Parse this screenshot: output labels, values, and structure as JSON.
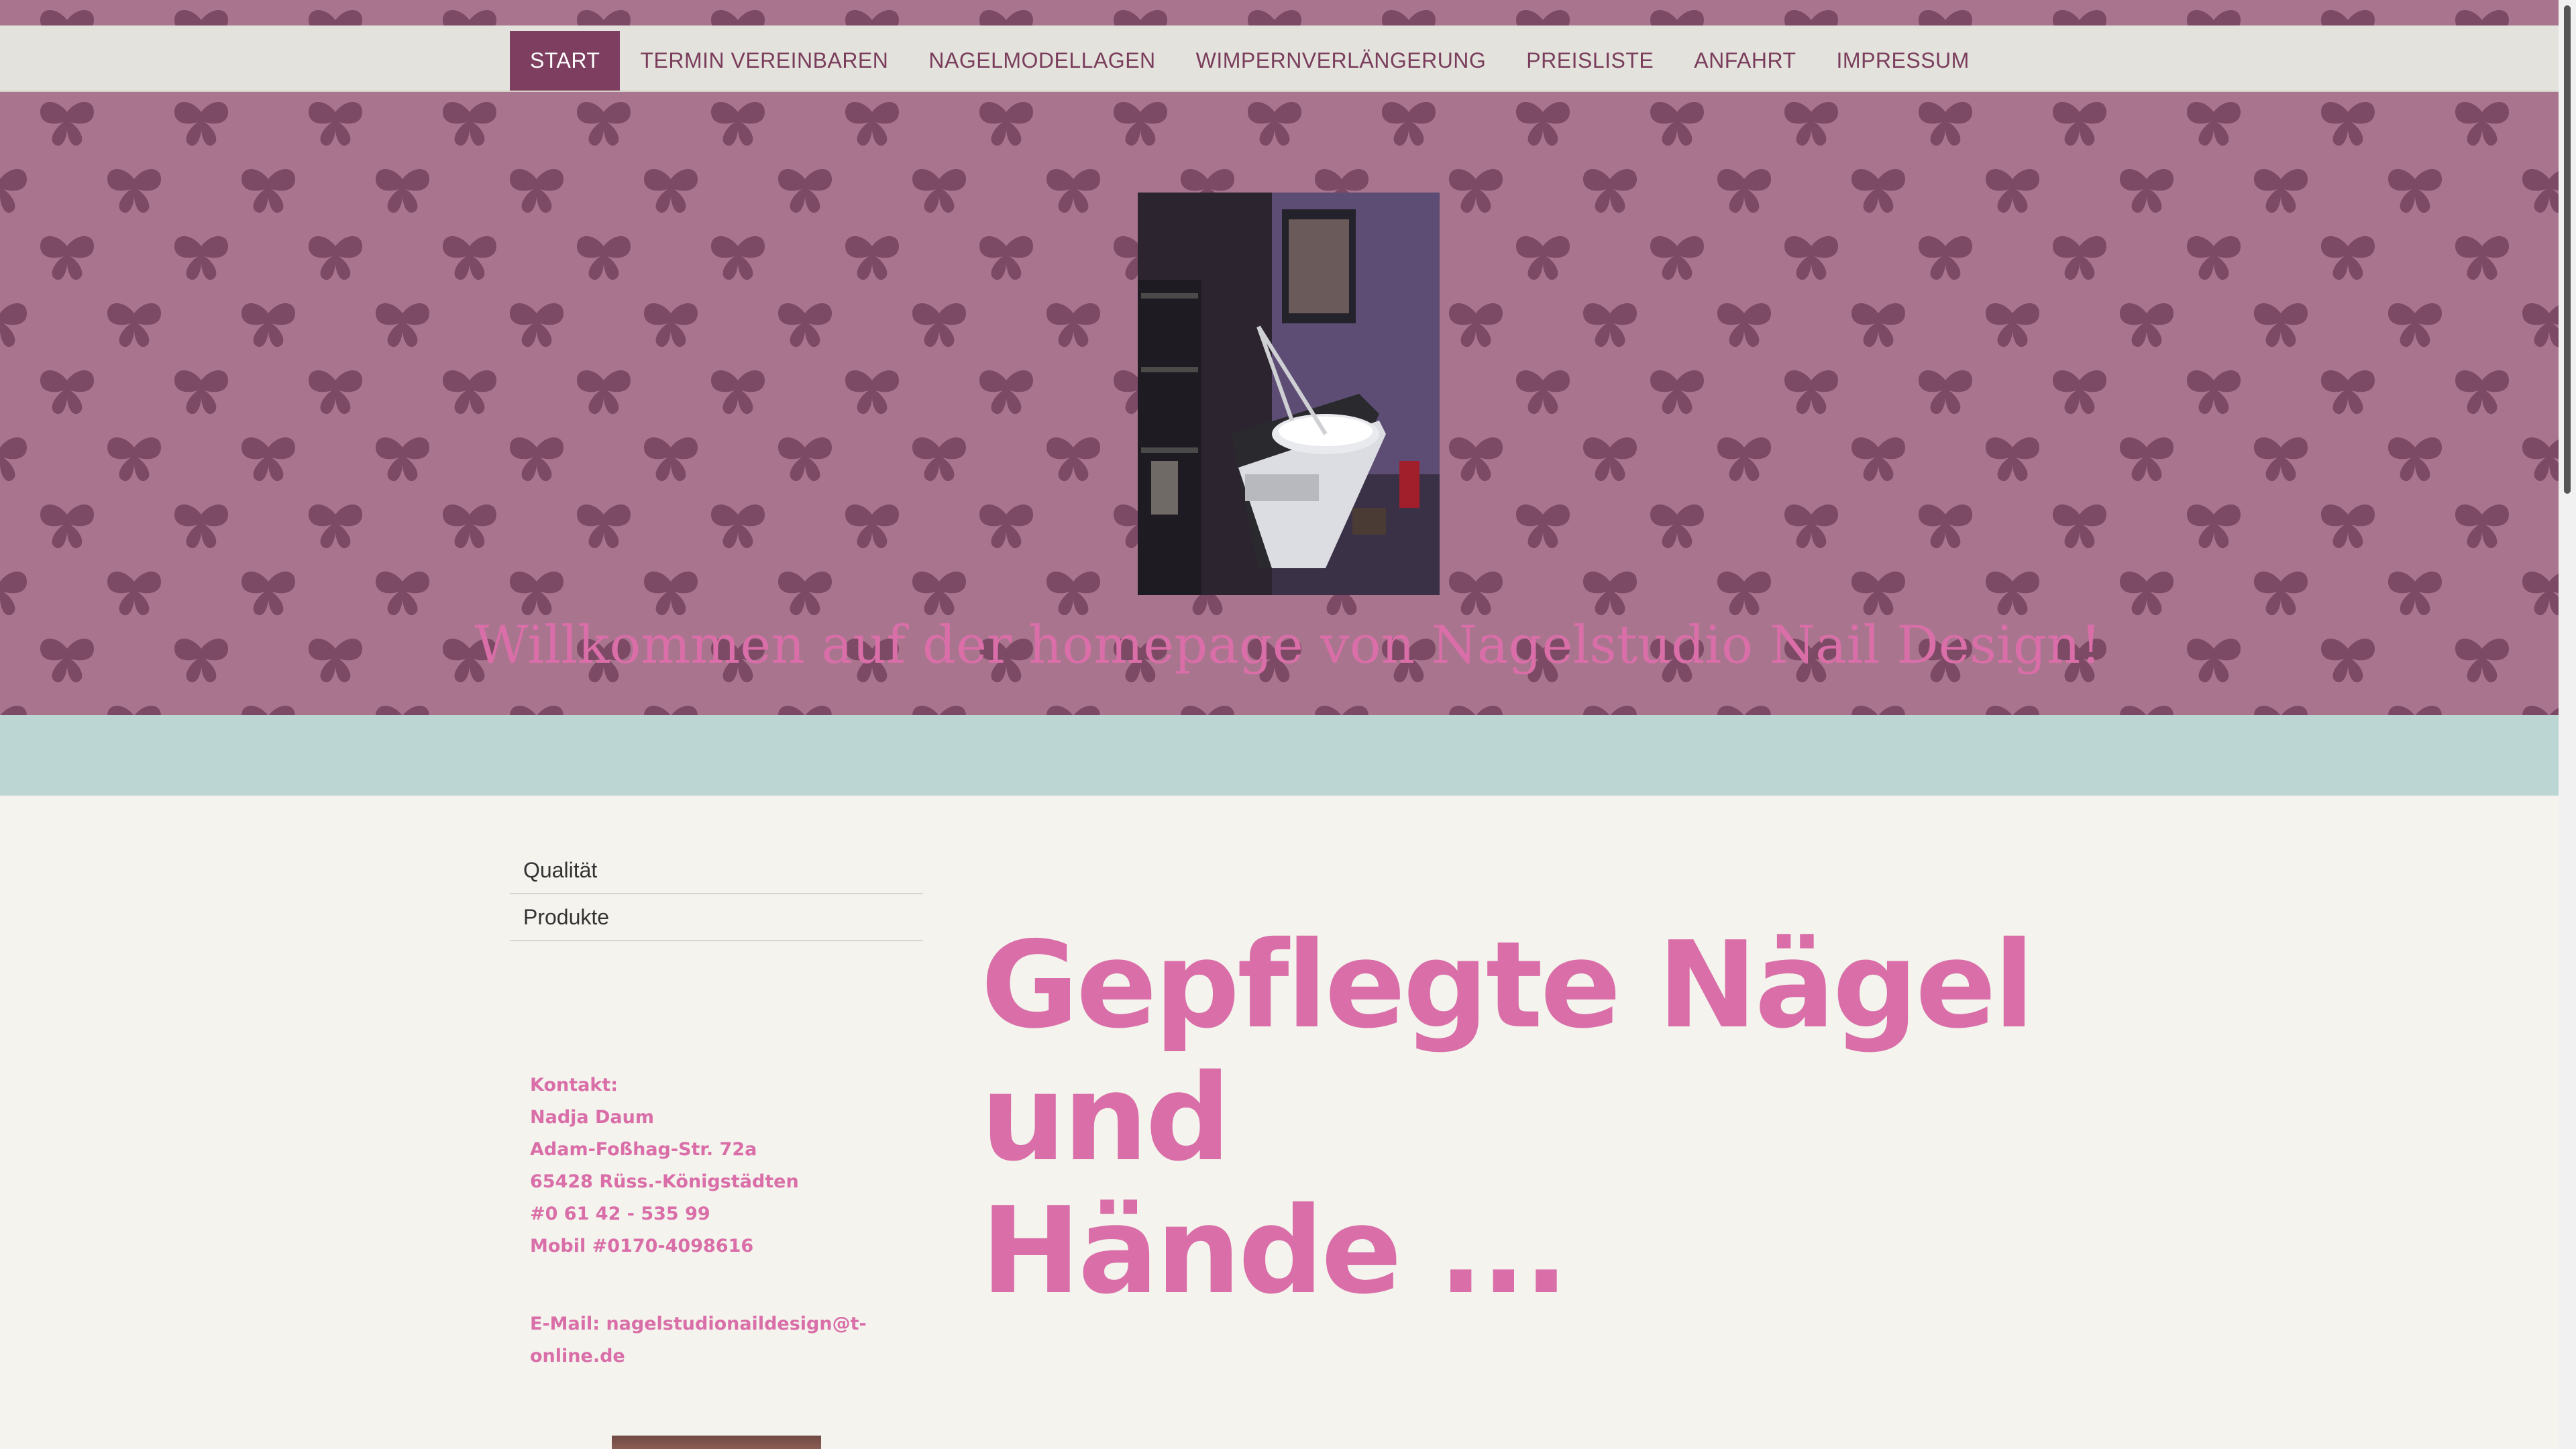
{
  "nav": {
    "items": [
      {
        "label": "START",
        "active": true
      },
      {
        "label": "TERMIN VEREINBAREN",
        "active": false
      },
      {
        "label": "NAGELMODELLAGEN",
        "active": false
      },
      {
        "label": "WIMPERNVERLÄNGERUNG",
        "active": false
      },
      {
        "label": "PREISLISTE",
        "active": false
      },
      {
        "label": "ANFAHRT",
        "active": false
      },
      {
        "label": "IMPRESSUM",
        "active": false
      }
    ]
  },
  "hero": {
    "title": "Willkommen auf der homepage von Nagelstudio Nail Design!"
  },
  "sidebar": {
    "items": [
      {
        "label": "Qualität"
      },
      {
        "label": "Produkte"
      }
    ]
  },
  "contact": {
    "heading": "Kontakt:",
    "name": "Nadja Daum",
    "street": "Adam-Foßhag-Str. 72a",
    "city": "65428 Rüss.-Königstädten",
    "phone": "#0 61 42 - 535 99",
    "mobile": "Mobil #0170-4098616",
    "email_label": "E-Mail:",
    "email": "nagelstudionaildesign@t-online.de"
  },
  "main": {
    "headline_line1": "Gepflegte Nägel und",
    "headline_line2": "Hände ..."
  },
  "colors": {
    "accent_pink": "#d96ea8",
    "nav_active": "#7e3e60",
    "hero_bg": "#a9758e",
    "band": "#bcd6d3"
  }
}
